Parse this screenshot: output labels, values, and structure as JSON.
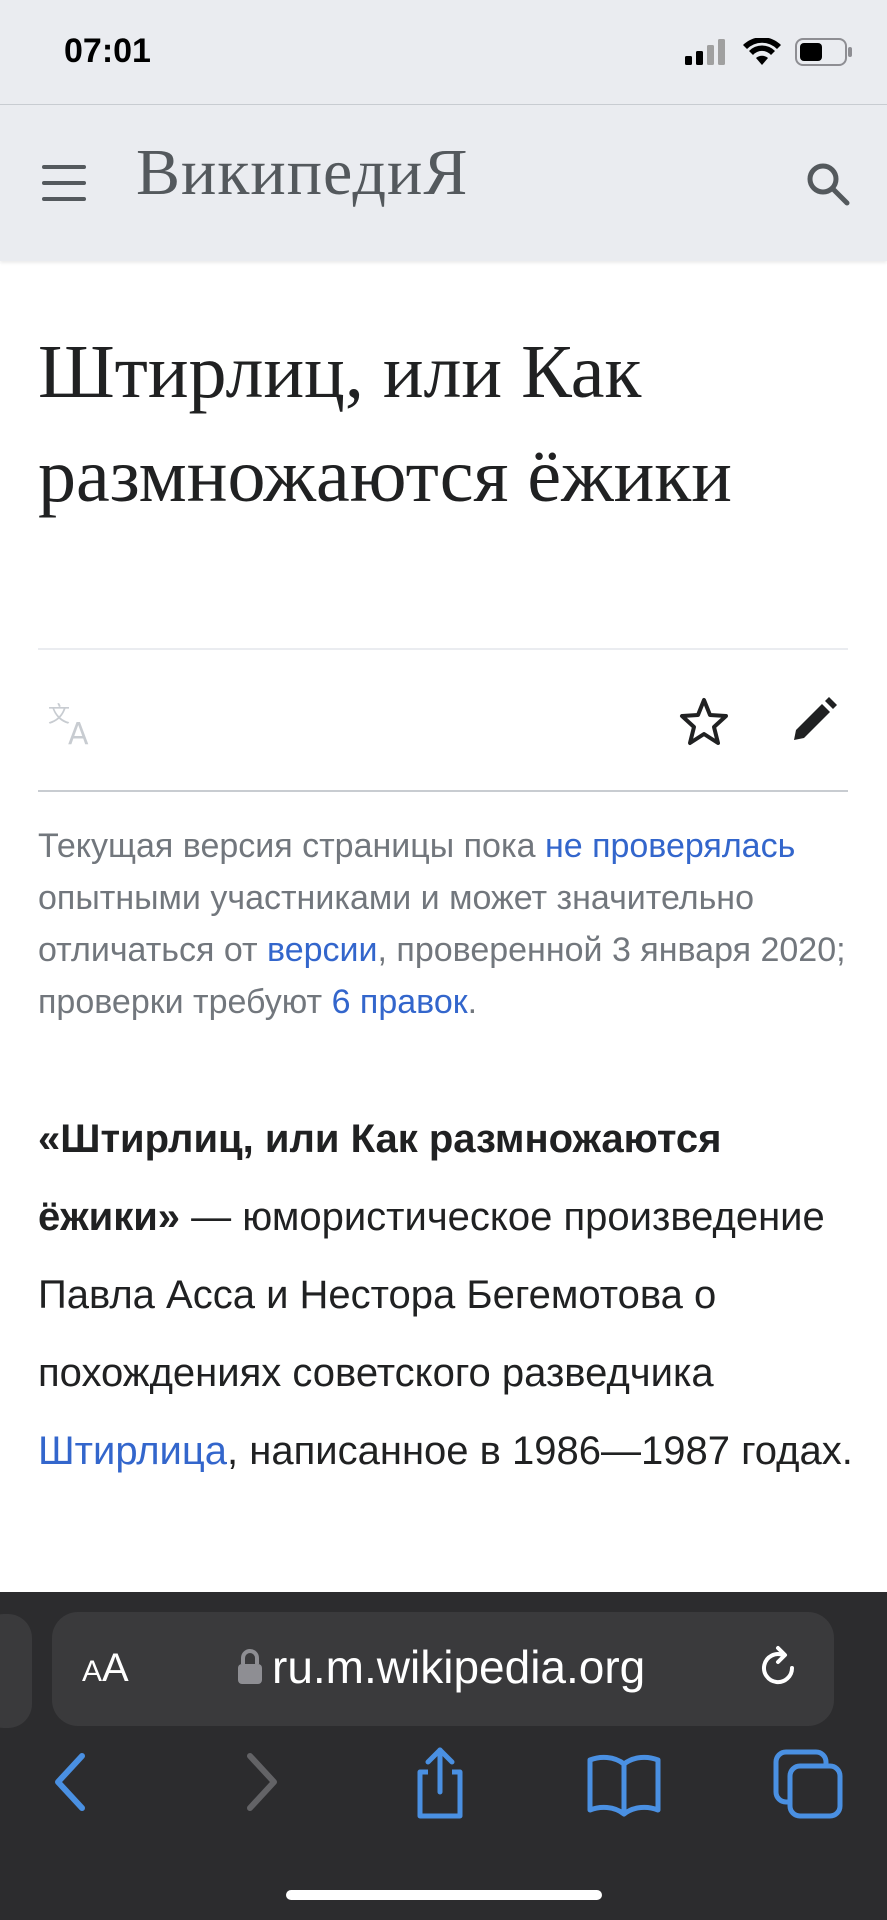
{
  "status_bar": {
    "time": "07:01"
  },
  "header": {
    "wordmark_main": "Википеди",
    "wordmark_end": "Я"
  },
  "article": {
    "title": "Штирлиц, или Как размножаются ёжики",
    "notice": {
      "t1": "Текущая версия страницы пока ",
      "link1": "не проверялась",
      "t2": " опытными участниками и может значительно отличаться от ",
      "link2": "версии",
      "t3": ", проверенной 3 января 2020; проверки требуют ",
      "link3": "6 правок",
      "t4": "."
    },
    "lead": {
      "bold": "«Штирлиц, или Как размножаются ёжики»",
      "t1": " — юмористическое произведение Павла Асса и Нестора Бегемотова о похождениях советского разведчика ",
      "link": "Штирлица",
      "t2": ", написанное в 1986—1987 годах."
    }
  },
  "browser": {
    "aa_small": "A",
    "aa_large": "A",
    "url": "ru.m.wikipedia.org"
  },
  "icons": {
    "menu": "hamburger-icon",
    "search": "search-icon",
    "language": "translate-icon",
    "watch": "star-icon",
    "edit": "pencil-icon",
    "back": "chevron-left-icon",
    "forward": "chevron-right-icon",
    "share": "share-icon",
    "bookmarks": "book-icon",
    "tabs": "tabs-icon"
  },
  "colors": {
    "link": "#3366cc",
    "text": "#202122",
    "muted": "#72777d",
    "header_bg": "#eaecf0",
    "toolbar_bg": "#2c2c2e",
    "toolbar_accent": "#4a90e2"
  }
}
